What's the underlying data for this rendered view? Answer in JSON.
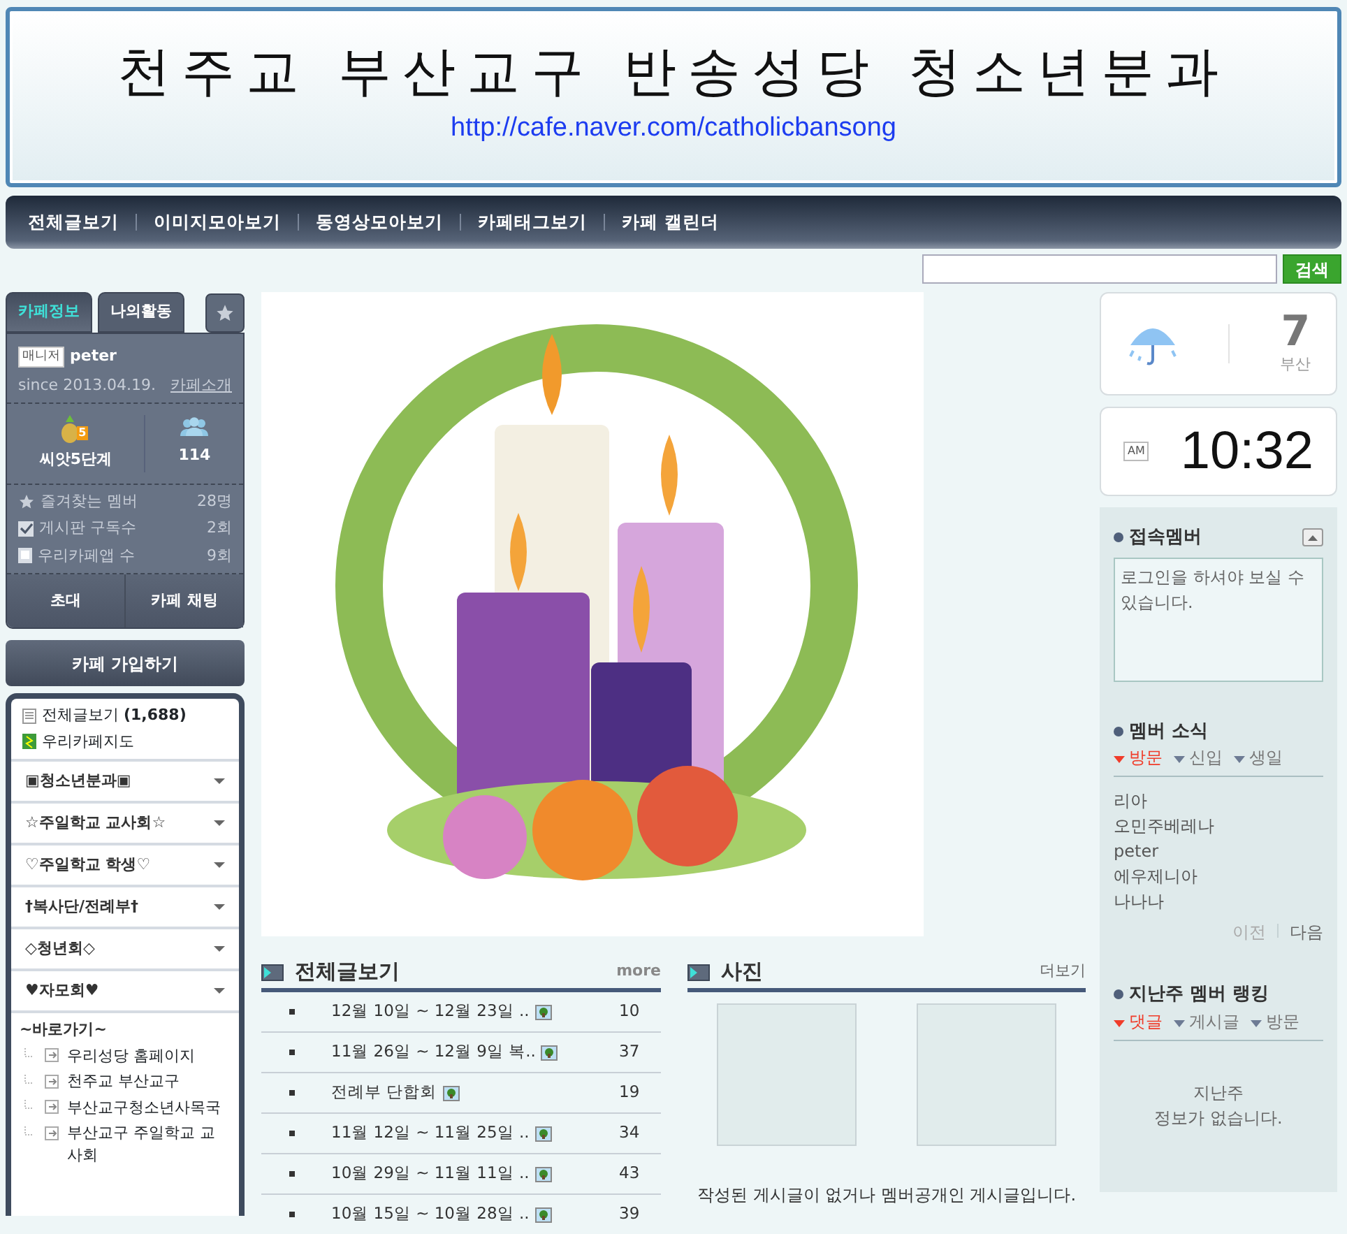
{
  "header": {
    "title": "천주교 부산교구 반송성당 청소년분과",
    "url": "http://cafe.naver.com/catholicbansong"
  },
  "menu": [
    "전체글보기",
    "이미지모아보기",
    "동영상모아보기",
    "카페태그보기",
    "카페 캘린더"
  ],
  "search": {
    "button": "검색"
  },
  "cafe_tabs": [
    {
      "label": "카페정보",
      "selected": true
    },
    {
      "label": "나의활동",
      "selected": false
    }
  ],
  "cafe_info": {
    "role": "매니저",
    "manager": "peter",
    "since": "since 2013.04.19.",
    "intro_link": "카페소개",
    "level": "씨앗5단계",
    "level_badge": "5",
    "members": "114",
    "stats": [
      {
        "kind": "star",
        "label": "즐겨찾는 멤버",
        "value": "28명"
      },
      {
        "kind": "check",
        "label": "게시판 구독수",
        "value": "2회"
      },
      {
        "kind": "phone",
        "label": "우리카페앱 수",
        "value": "9회"
      }
    ],
    "buttons": [
      "초대",
      "카페 채팅"
    ],
    "join": "카페 가입하기"
  },
  "board_top": [
    {
      "kind": "list",
      "label": "전체글보기",
      "count": "(1,688)"
    },
    {
      "kind": "map",
      "label": "우리카페지도"
    }
  ],
  "board_groups": [
    "▣청소년분과▣",
    "☆주일학교 교사회☆",
    "♡주일학교 학생♡",
    "†복사단/전례부†",
    "◇청년회◇",
    "♥자모회♥"
  ],
  "shortcuts": {
    "title": "~바로가기~",
    "links": [
      "우리성당 홈페이지",
      "천주교 부산교구",
      "부산교구청소년사목국",
      "부산교구 주일학교 교사회"
    ]
  },
  "main_picture": {
    "kind": "picture"
  },
  "all_posts": {
    "title": "전체글보기",
    "more": "more",
    "rows": [
      {
        "title": "12월 10일 ~ 12월 23일 ..",
        "count": "10"
      },
      {
        "title": "11월 26일 ~ 12월 9일 복..",
        "count": "37"
      },
      {
        "title": "전례부 단합회",
        "count": "19"
      },
      {
        "title": "11월 12일 ~ 11월 25일 ..",
        "count": "34"
      },
      {
        "title": "10월 29일 ~ 11월 11일 ..",
        "count": "43"
      },
      {
        "title": "10월 15일 ~ 10월 28일 ..",
        "count": "39"
      }
    ]
  },
  "photos": {
    "title": "사진",
    "more": "더보기",
    "empty": "작성된 게시글이 없거나 멤버공개인 게시글입니다."
  },
  "weather": {
    "temp": "7",
    "city": "부산"
  },
  "clock": {
    "ampm": "AM",
    "time": "10:32"
  },
  "online": {
    "title": "접속멤버",
    "message": "로그인을 하셔야 보실 수 있습니다."
  },
  "member_news": {
    "title": "멤버 소식",
    "tabs": [
      {
        "label": "방문",
        "selected": true
      },
      {
        "label": "신입",
        "selected": false
      },
      {
        "label": "생일",
        "selected": false
      }
    ],
    "members": [
      "리아",
      "오민주베레나",
      "peter",
      "에우제니아",
      "나나나"
    ],
    "prev": "이전",
    "next": "다음"
  },
  "ranking": {
    "title": "지난주 멤버 랭킹",
    "tabs": [
      {
        "label": "댓글",
        "selected": true
      },
      {
        "label": "게시글",
        "selected": false
      },
      {
        "label": "방문",
        "selected": false
      }
    ],
    "empty": "지난주\n정보가 없습니다."
  }
}
